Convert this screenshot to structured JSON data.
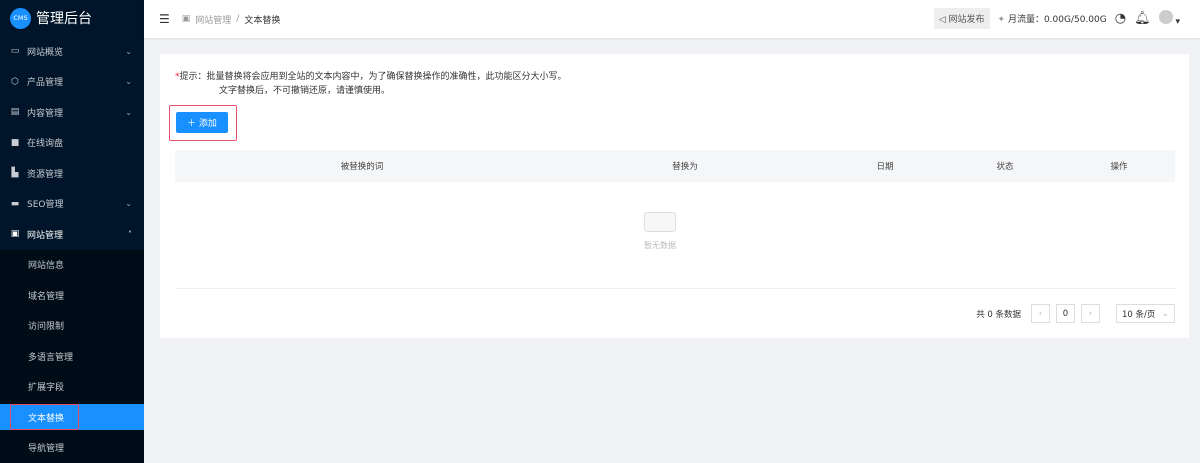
{
  "app": {
    "logo_badge": "CMS",
    "title": "管理后台"
  },
  "sidebar": {
    "items": [
      {
        "label": "网站概览",
        "icon": "monitor-icon"
      },
      {
        "label": "产品管理",
        "icon": "cube-icon"
      },
      {
        "label": "内容管理",
        "icon": "document-icon"
      },
      {
        "label": "在线询盘",
        "icon": "chat-icon"
      },
      {
        "label": "资源管理",
        "icon": "folder-icon"
      },
      {
        "label": "SEO管理",
        "icon": "seo-icon"
      },
      {
        "label": "网站管理",
        "icon": "website-icon"
      }
    ],
    "sub_items": [
      "网站信息",
      "域名管理",
      "访问限制",
      "多语言管理",
      "扩展字段",
      "文本替换",
      "导航管理"
    ]
  },
  "header": {
    "breadcrumb": [
      "网站管理",
      "文本替换"
    ],
    "publish": "网站发布",
    "traffic": "月流量：0.00G/50.00G"
  },
  "main": {
    "tip_line1": "提示：批量替换将会应用到全站的文本内容中，为了确保替换操作的准确性，此功能区分大小写。",
    "tip_line2": "文字替换后，不可撤销还原，请谨慎使用。",
    "add_label": "添加",
    "columns": [
      "被替换的词",
      "替换为",
      "日期",
      "状态",
      "操作"
    ],
    "empty_text": "暂无数据"
  },
  "pagination": {
    "total": "共 0 条数据",
    "page": "0",
    "page_size": "10 条/页"
  }
}
